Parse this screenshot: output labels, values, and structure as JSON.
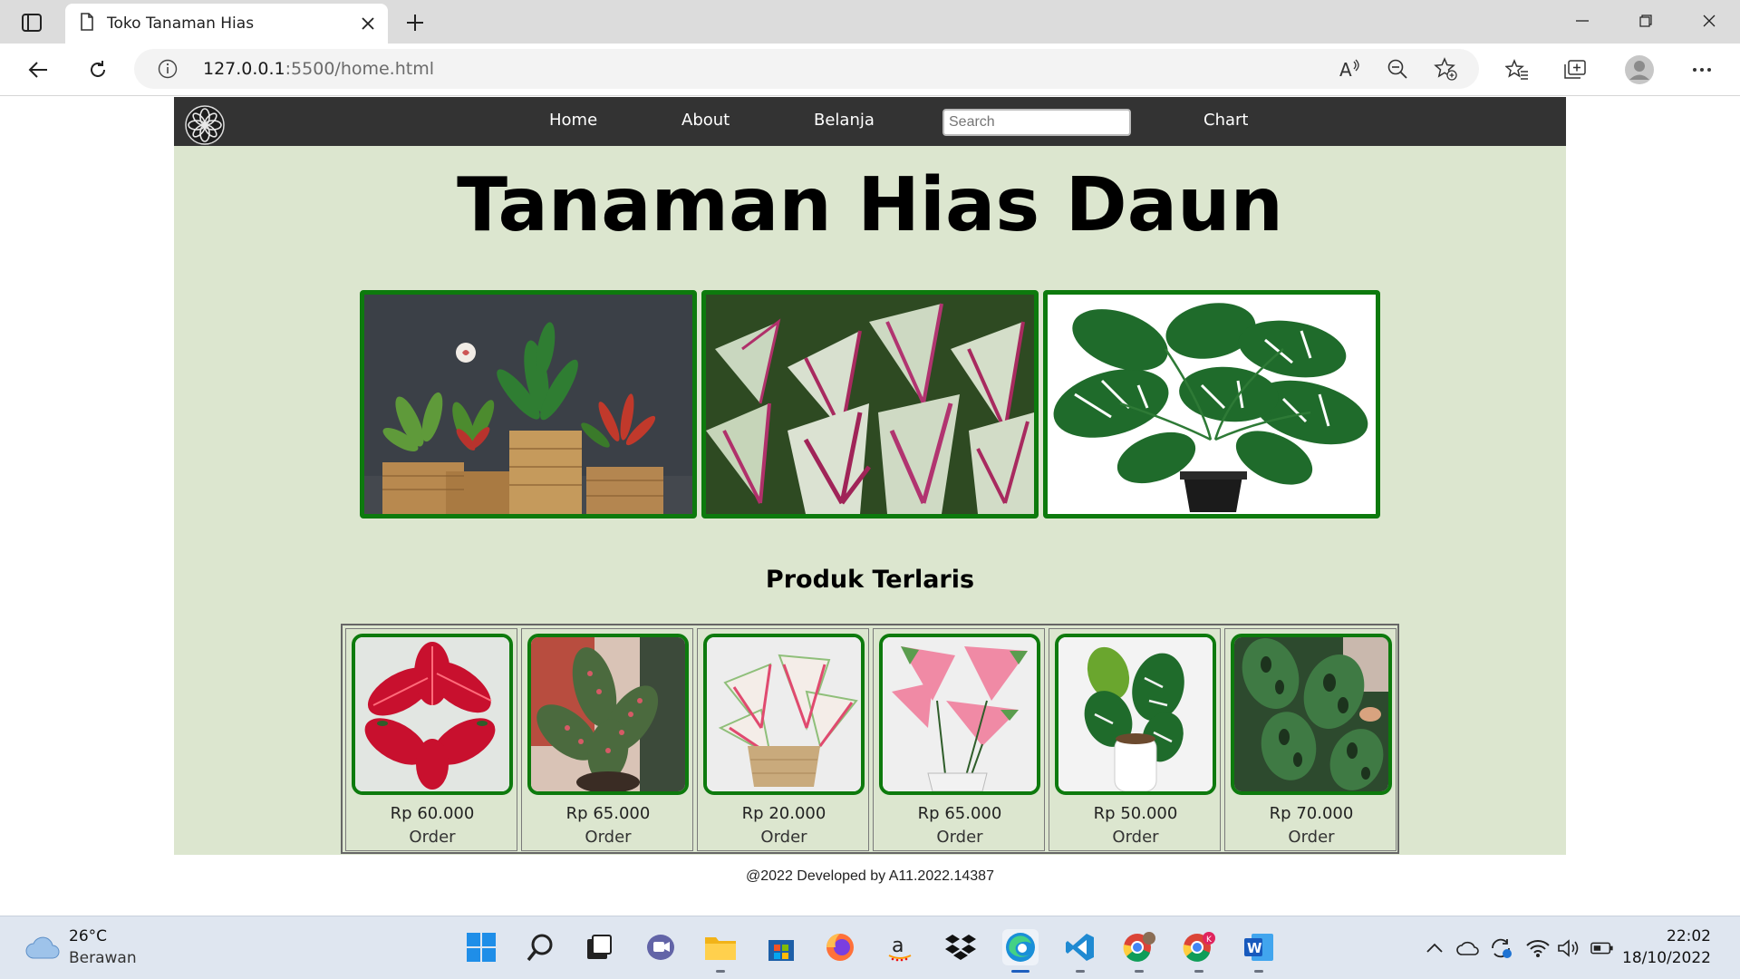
{
  "browser": {
    "tab_title": "Toko Tanaman Hias",
    "url_host": "127.0.0.1",
    "url_path": ":5500/home.html"
  },
  "site": {
    "nav": {
      "home": "Home",
      "about": "About",
      "belanja": "Belanja",
      "search_placeholder": "Search",
      "chart": "Chart"
    },
    "hero_title": "Tanaman Hias Daun",
    "section_title": "Produk Terlaris",
    "products": [
      {
        "price": "Rp 60.000",
        "order": "Order"
      },
      {
        "price": "Rp 65.000",
        "order": "Order"
      },
      {
        "price": "Rp 20.000",
        "order": "Order"
      },
      {
        "price": "Rp 65.000",
        "order": "Order"
      },
      {
        "price": "Rp 50.000",
        "order": "Order"
      },
      {
        "price": "Rp 70.000",
        "order": "Order"
      }
    ],
    "footer": "@2022 Developed by A11.2022.14387",
    "accent_color": "#0d7a0d",
    "navbar_color": "#333333",
    "page_bg_color": "#dce6cf"
  },
  "taskbar": {
    "weather_temp": "26°C",
    "weather_desc": "Berawan",
    "time": "22:02",
    "date": "18/10/2022"
  }
}
